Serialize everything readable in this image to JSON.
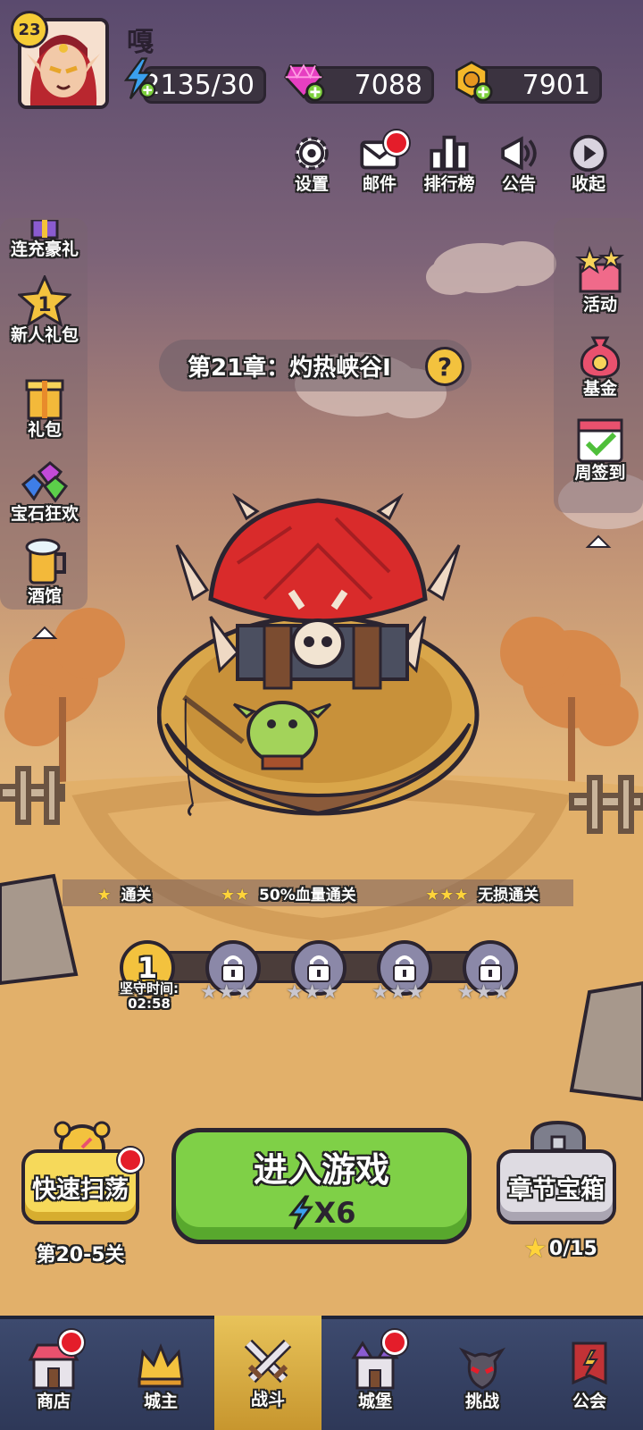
{
  "player": {
    "level": "23",
    "name": "嘎"
  },
  "resources": {
    "energy": "2135/30",
    "gems": "7088",
    "gold": "7901"
  },
  "top_buttons": [
    {
      "label": "设置",
      "icon": "gear-icon"
    },
    {
      "label": "邮件",
      "icon": "mail-icon"
    },
    {
      "label": "排行榜",
      "icon": "leaderboard-icon"
    },
    {
      "label": "公告",
      "icon": "megaphone-icon"
    },
    {
      "label": "收起",
      "icon": "collapse-icon"
    }
  ],
  "left_menu": [
    {
      "label": "连充豪礼",
      "icon": "gift-box-icon"
    },
    {
      "label": "新人礼包",
      "icon": "star-badge-icon",
      "badge": "1"
    },
    {
      "label": "礼包",
      "icon": "gift-icon"
    },
    {
      "label": "宝石狂欢",
      "icon": "gems-icon"
    },
    {
      "label": "酒馆",
      "icon": "beer-mug-icon"
    }
  ],
  "right_menu": [
    {
      "label": "活动",
      "icon": "event-gift-icon"
    },
    {
      "label": "基金",
      "icon": "money-bag-icon"
    },
    {
      "label": "周签到",
      "icon": "calendar-check-icon"
    }
  ],
  "chapter": {
    "title": "第21章：灼热峡谷Ⅰ",
    "help": "?"
  },
  "star_legend": [
    {
      "stars": "★",
      "text": "通关"
    },
    {
      "stars": "★★",
      "text": "50%血量通关"
    },
    {
      "stars": "★★★",
      "text": "无损通关"
    }
  ],
  "progress": {
    "current_node": "1",
    "hold_time_label": "坚守时间:",
    "hold_time": "02:58",
    "stars": "★★★"
  },
  "actions": {
    "enter_label": "进入游戏",
    "enter_cost": "X6",
    "sweep_label": "快速扫荡",
    "sweep_stage": "第20-5关",
    "chest_label": "章节宝箱",
    "chest_progress": "0/15"
  },
  "nav": [
    {
      "label": "商店",
      "icon": "shop-icon",
      "active": false
    },
    {
      "label": "城主",
      "icon": "crown-icon",
      "active": false
    },
    {
      "label": "战斗",
      "icon": "crossed-swords-icon",
      "active": true
    },
    {
      "label": "城堡",
      "icon": "castle-icon",
      "active": false
    },
    {
      "label": "挑战",
      "icon": "demon-mask-icon",
      "active": false
    },
    {
      "label": "公会",
      "icon": "guild-banner-icon",
      "active": false
    }
  ],
  "colors": {
    "accent_green": "#7fd047",
    "gold": "#f6cc36",
    "red_dot": "#e41d2a",
    "nav_bg": "#2e3858"
  }
}
